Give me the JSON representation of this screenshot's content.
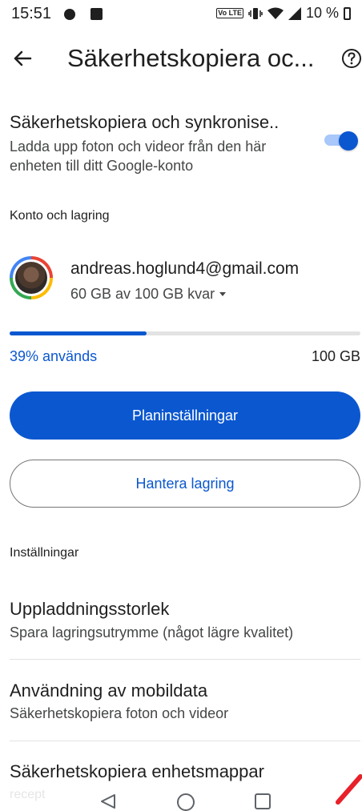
{
  "status_bar": {
    "time": "15:51",
    "volte": "Vo LTE",
    "battery": "10 %",
    "icons": [
      "dnd-icon",
      "image-icon",
      "vibrate-icon",
      "wifi-icon",
      "signal-icon",
      "battery-icon"
    ]
  },
  "app_bar": {
    "title": "Säkerhetskopiera oc...",
    "back_icon": "arrow-back-icon",
    "help_icon": "help-circle-icon"
  },
  "backup": {
    "title": "Säkerhetskopiera och synkronise..",
    "description": "Ladda upp foton och videor från den här enheten till ditt Google-konto",
    "enabled": true
  },
  "account_section": {
    "header": "Konto och lagring",
    "email": "andreas.hoglund4@gmail.com",
    "storage_summary": "60 GB av 100 GB kvar",
    "used_fraction": 0.39,
    "used_label": "39% används",
    "total_label": "100 GB"
  },
  "buttons": {
    "plan_settings": "Planinställningar",
    "manage_storage": "Hantera lagring"
  },
  "settings": {
    "header": "Inställningar",
    "items": [
      {
        "title": "Uppladdningsstorlek",
        "subtitle": "Spara lagringsutrymme (något lägre kvalitet)"
      },
      {
        "title": "Användning av mobildata",
        "subtitle": "Säkerhetskopiera foton och videor"
      },
      {
        "title": "Säkerhetskopiera enhetsmappar",
        "subtitle": ""
      }
    ]
  },
  "nav_bar": {
    "ghost_text": "recept"
  },
  "colors": {
    "accent": "#0b57d0",
    "toggle_track": "#a8c7fa",
    "bar_track": "#e3e3e3",
    "text_primary": "#1f1f1f",
    "text_secondary": "#444746"
  }
}
